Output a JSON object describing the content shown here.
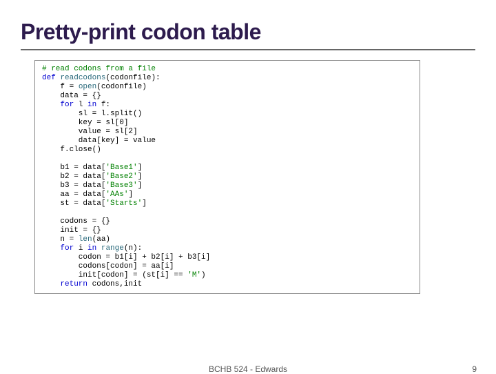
{
  "title": "Pretty-print codon table",
  "footer": {
    "center": "BCHB 524 - Edwards",
    "page": "9"
  },
  "code": {
    "l1": "# read codons from a file",
    "kw_def": "def",
    "fn_read": "readcodons",
    "l2_tail": "(codonfile):",
    "l3a": "    f = ",
    "fn_open": "open",
    "l3b": "(codonfile)",
    "l4": "    data = {}",
    "kw_for1": "for",
    "kw_in1": "in",
    "l5a": "    ",
    "l5b": " l ",
    "l5c": " f:",
    "l6": "        sl = l.split()",
    "l7": "        key = sl[0]",
    "l8": "        value = sl[2]",
    "l9": "        data[key] = value",
    "l10": "    f.close()",
    "l11a": "    b1 = data[",
    "s11": "'Base1'",
    "close": "]",
    "l12a": "    b2 = data[",
    "s12": "'Base2'",
    "l13a": "    b3 = data[",
    "s13": "'Base3'",
    "l14a": "    aa = data[",
    "s14": "'AAs'",
    "l15a": "    st = data[",
    "s15": "'Starts'",
    "l16": "    codons = {}",
    "l17": "    init = {}",
    "l18a": "    n = ",
    "fn_len": "len",
    "l18b": "(aa)",
    "kw_for2": "for",
    "kw_in2": "in",
    "l19a": "    ",
    "l19b": " i ",
    "fn_range": "range",
    "l19c": "(n):",
    "l20": "        codon = b1[i] + b2[i] + b3[i]",
    "l21": "        codons[codon] = aa[i]",
    "l22": "        init[codon] = (st[i] == ",
    "s22": "'M'",
    "l22b": ")",
    "kw_return": "return",
    "l23a": "    ",
    "l23b": " codons,init"
  }
}
